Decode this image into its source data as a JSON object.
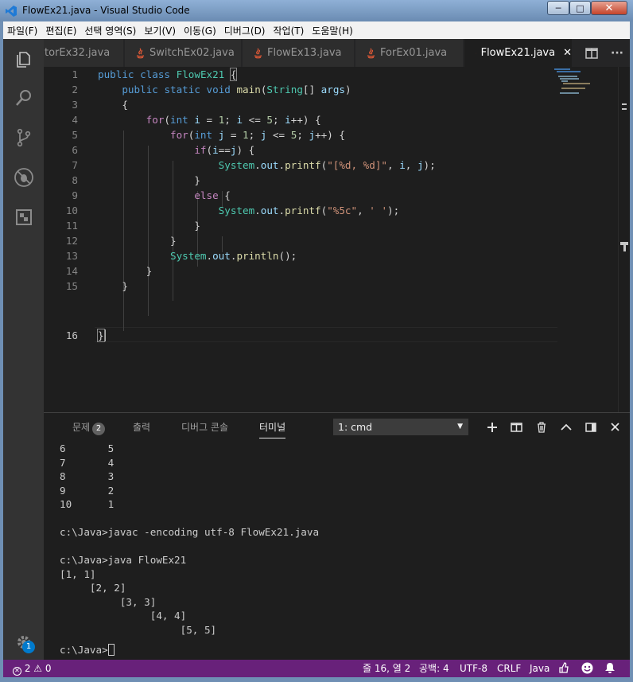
{
  "window": {
    "title": "FlowEx21.java - Visual Studio Code",
    "min_label": "─",
    "max_label": "□",
    "close_label": "✕"
  },
  "menu": [
    "파일(F)",
    "편집(E)",
    "선택 영역(S)",
    "보기(V)",
    "이동(G)",
    "디버그(D)",
    "작업(T)",
    "도움말(H)"
  ],
  "tabs": [
    {
      "label": "atorEx32.java"
    },
    {
      "label": "SwitchEx02.java"
    },
    {
      "label": "FlowEx13.java"
    },
    {
      "label": "ForEx01.java"
    },
    {
      "label": "FlowEx21.java",
      "close": "✕"
    }
  ],
  "tab_actions": {
    "more": "···"
  },
  "editor": {
    "line_numbers": [
      "1",
      "2",
      "3",
      "4",
      "5",
      "6",
      "7",
      "8",
      "9",
      "10",
      "11",
      "12",
      "13",
      "14",
      "15",
      "16"
    ],
    "current_line": "16"
  },
  "panel": {
    "tabs": {
      "problems": "문제",
      "problems_count": "2",
      "output": "출력",
      "debug_console": "디버그 콘솔",
      "terminal": "터미널"
    },
    "terminal_select": "1: cmd",
    "terminal_lines": [
      "6       5",
      "7       4",
      "8       3",
      "9       2",
      "10      1",
      "",
      "c:\\Java>javac -encoding utf-8 FlowEx21.java",
      "",
      "c:\\Java>java FlowEx21",
      "[1, 1]",
      "     [2, 2]",
      "          [3, 3]",
      "               [4, 4]",
      "                    [5, 5]",
      "",
      "c:\\Java>"
    ]
  },
  "activity": {
    "settings_badge": "1"
  },
  "status": {
    "errors": "2",
    "warnings": "0",
    "position": "줄 16, 열 2",
    "indent": "공백: 4",
    "encoding": "UTF-8",
    "eol": "CRLF",
    "language": "Java"
  },
  "colors": {
    "statusbar": "#68217a",
    "accent": "#007acc",
    "java_icon": "#e35a37"
  }
}
